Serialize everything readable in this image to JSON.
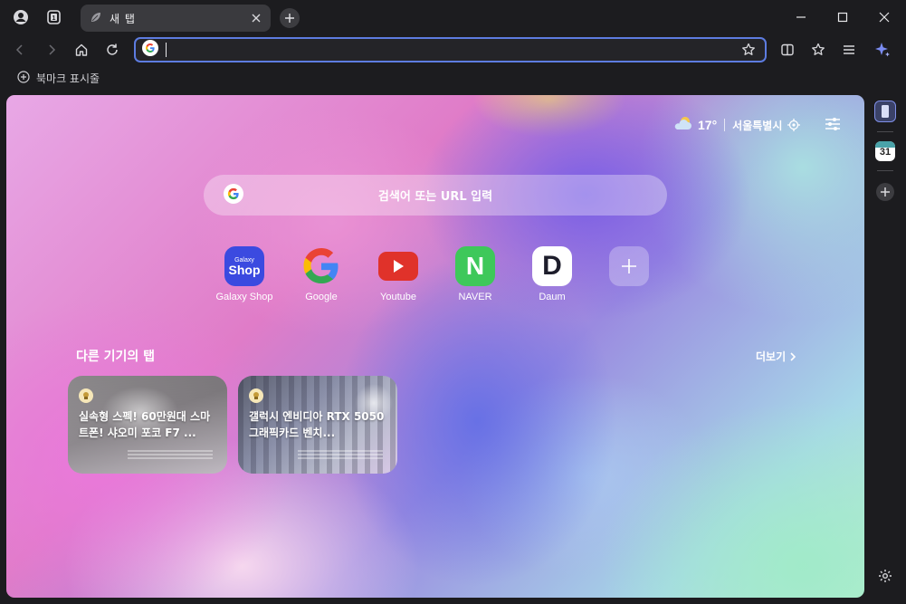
{
  "tabs": [
    {
      "label": "새 탭",
      "icon": "leaf-icon",
      "active": true
    }
  ],
  "toolbar": {
    "address_value": "",
    "address_placeholder": ""
  },
  "bookmarks_bar": {
    "label": "북마크 표시줄"
  },
  "new_tab_page": {
    "weather": {
      "temperature": "17°",
      "condition_icon": "partly-cloudy-icon",
      "location": "서울특별시"
    },
    "search": {
      "placeholder": "검색어 또는 URL 입력"
    },
    "shortcuts": [
      {
        "label": "Galaxy Shop",
        "icon_text_top": "Galaxy",
        "icon_text_main": "Shop",
        "color": "#3b4ae0"
      },
      {
        "label": "Google",
        "icon": "google-icon"
      },
      {
        "label": "Youtube",
        "icon": "youtube-icon",
        "color": "#e0322a"
      },
      {
        "label": "NAVER",
        "icon_text_main": "N",
        "color": "#3ec85a"
      },
      {
        "label": "Daum",
        "icon_text_main": "D",
        "color": "#ffffff"
      },
      {
        "label": "",
        "icon": "plus-icon"
      }
    ],
    "other_devices": {
      "title": "다른 기기의 탭",
      "more_label": "더보기",
      "cards": [
        {
          "title": "실속형 스펙! 60만원대 스마트폰! 샤오미 포코 F7 ..."
        },
        {
          "title": "갤럭시 엔비디아 RTX 5050 그래픽카드 벤치..."
        }
      ]
    }
  },
  "sidebar": {
    "calendar_day": "31"
  },
  "colors": {
    "accent": "#5d7ce0",
    "chrome_bg": "#1c1c1f"
  }
}
